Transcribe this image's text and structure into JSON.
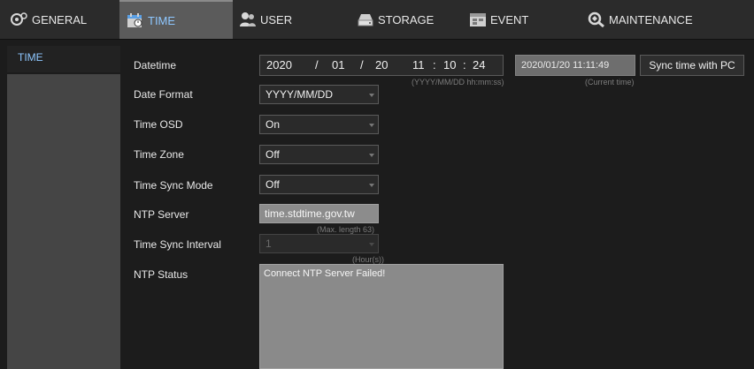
{
  "tabs": {
    "general": "GENERAL",
    "time": "TIME",
    "user": "USER",
    "storage": "STORAGE",
    "event": "EVENT",
    "maintenance": "MAINTENANCE"
  },
  "sidebar": {
    "item_time": "TIME"
  },
  "form": {
    "datetime_label": "Datetime",
    "datetime": {
      "year": "2020",
      "sep1": "/",
      "month": "01",
      "sep2": "/",
      "day": "20",
      "hour": "11",
      "sep3": ":",
      "minute": "10",
      "sep4": ":",
      "second": "24",
      "format_hint": "(YYYY/MM/DD hh:mm:ss)"
    },
    "current_time": "2020/01/20 11:11:49",
    "current_time_hint": "(Current time)",
    "sync_button": "Sync time with PC",
    "date_format_label": "Date Format",
    "date_format_value": "YYYY/MM/DD",
    "time_osd_label": "Time OSD",
    "time_osd_value": "On",
    "time_zone_label": "Time Zone",
    "time_zone_value": "Off",
    "time_sync_mode_label": "Time Sync Mode",
    "time_sync_mode_value": "Off",
    "ntp_server_label": "NTP Server",
    "ntp_server_value": "time.stdtime.gov.tw",
    "ntp_server_hint": "(Max. length 63)",
    "time_sync_interval_label": "Time Sync Interval",
    "time_sync_interval_value": "1",
    "time_sync_interval_hint": "(Hour(s))",
    "ntp_status_label": "NTP Status",
    "ntp_status_value": "Connect NTP Server Failed!"
  },
  "colors": {
    "active_tab_text": "#8ec7ff",
    "background": "#1c1c1c",
    "nav_background": "#2b2b2b",
    "active_tab_background": "#5b5b5b"
  }
}
